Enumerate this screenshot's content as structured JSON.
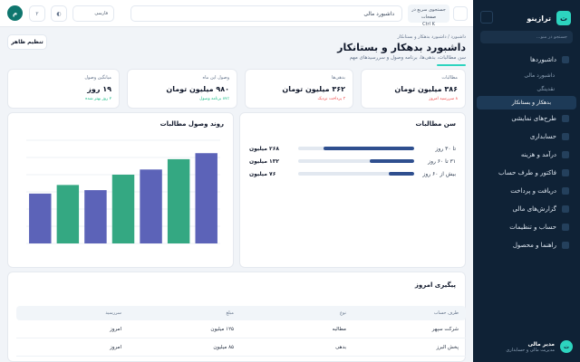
{
  "sidebar": {
    "brand": "ترازینو",
    "logo_letter": "ت",
    "search_placeholder": "جستجو در منو...",
    "items": [
      {
        "label": "داشبوردها"
      },
      {
        "label": "طرح‌های نمایشی"
      },
      {
        "label": "حسابداری"
      },
      {
        "label": "درآمد و هزینه"
      },
      {
        "label": "فاکتور و طرف حساب"
      },
      {
        "label": "دریافت و پرداخت"
      },
      {
        "label": "گزارش‌های مالی"
      },
      {
        "label": "حساب و تنظیمات"
      },
      {
        "label": "راهنما و محصول"
      }
    ],
    "sub_items": [
      {
        "label": "داشبورد مالی"
      },
      {
        "label": "نقدینگی"
      },
      {
        "label": "بدهکار و بستانکار"
      }
    ],
    "user": {
      "initial": "ت",
      "name": "مدیر مالی",
      "role": "مدیریت مالی و حسابداری"
    }
  },
  "topbar": {
    "search_value": "داشبورد مالی",
    "chip_text": "جستجوی سریع در صفحات",
    "chip_shortcut": "Ctrl K",
    "language": "فارسی",
    "notification_badge": "۲",
    "avatar_initial": "م"
  },
  "header": {
    "breadcrumb": "داشبورد / داشبورد بدهکار و بستانکار",
    "title": "داشبورد بدهکار و بستانکار",
    "subtitle": "سن مطالبات، بدهی‌ها، برنامه وصول و سررسیدهای مهم",
    "layout_button": "تنظیم ظاهر"
  },
  "kpis": [
    {
      "label": "مطالبات",
      "value": "۳۸۶ میلیون تومان",
      "note": "۸ سررسید امروز",
      "note_color": "#ef4444"
    },
    {
      "label": "بدهی‌ها",
      "value": "۳۶۲ میلیون تومان",
      "note": "۳ پرداخت نزدیک",
      "note_color": "#ef4444"
    },
    {
      "label": "وصول این ماه",
      "value": "۹۸۰ میلیون تومان",
      "note": "۸۷٪ برنامه وصول",
      "note_color": "#10b981"
    },
    {
      "label": "میانگین وصول",
      "value": "۱۹ روز",
      "note": "۲ روز بهتر شده",
      "note_color": "#10b981"
    }
  ],
  "aging": {
    "title": "سن مطالبات",
    "rows": [
      {
        "range": "تا ۳۰ روز",
        "amount": "۲۶۸ میلیون",
        "share": 0.78,
        "color": "#2f4f8f"
      },
      {
        "range": "۳۱ تا ۶۰ روز",
        "amount": "۱۳۲ میلیون",
        "share": 0.38,
        "color": "#2f4f8f"
      },
      {
        "range": "بیش از ۶۰ روز",
        "amount": "۷۶ میلیون",
        "share": 0.22,
        "color": "#2f4f8f"
      }
    ]
  },
  "trend": {
    "title": "روند وصول مطالبات"
  },
  "chart_data": {
    "type": "bar",
    "title": "روند وصول مطالبات",
    "values": [
      58,
      68,
      62,
      80,
      86,
      98,
      105
    ],
    "colors": [
      "#5c63b8",
      "#34a882",
      "#5c63b8",
      "#34a882",
      "#5c63b8",
      "#34a882",
      "#5c63b8"
    ],
    "ylim": [
      0,
      120
    ],
    "grid": true
  },
  "followup": {
    "title": "پیگیری امروز",
    "columns": [
      "طرف حساب",
      "نوع",
      "مبلغ",
      "سررسید"
    ],
    "rows": [
      [
        "شرکت سپهر",
        "مطالبه",
        "۱۲۵ میلیون",
        "امروز"
      ],
      [
        "پخش البرز",
        "بدهی",
        "۸۵ میلیون",
        "امروز"
      ]
    ]
  }
}
